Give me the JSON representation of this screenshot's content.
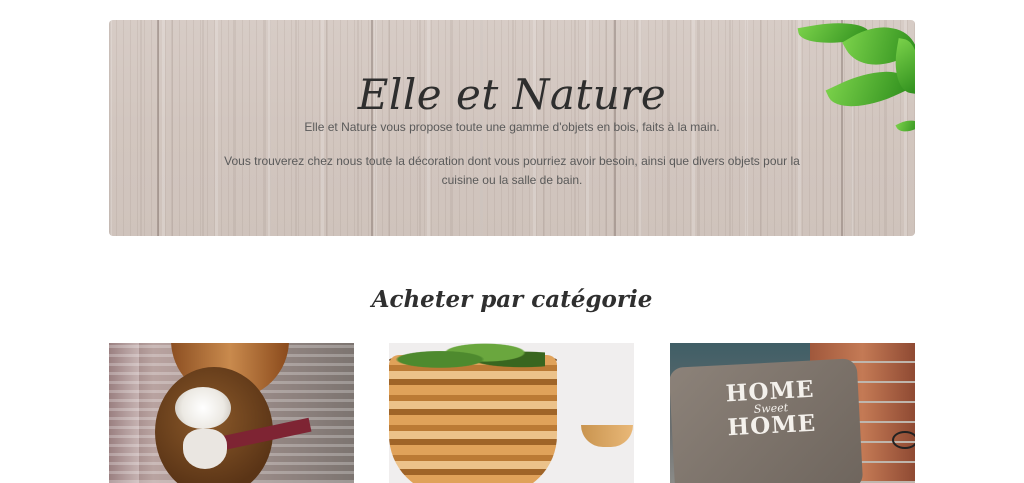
{
  "hero": {
    "title": "Elle et Nature",
    "line1": "Elle et Nature vous propose toute une gamme d'objets en bois, faits à la main.",
    "line2": "Vous trouverez chez nous toute la décoration dont vous pourriez avoir besoin, ainsi que divers objets pour la cuisine ou la salle de bain."
  },
  "section": {
    "title": "Acheter par catégorie"
  },
  "categories": [
    {
      "pillow_text_home": "HOME",
      "pillow_text_sweet": "Sweet",
      "pillow_text_home2": "HOME"
    }
  ]
}
